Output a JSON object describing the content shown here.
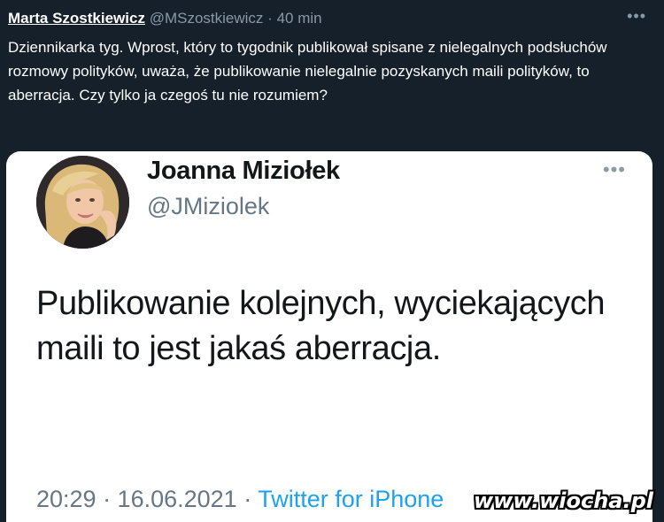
{
  "tweet": {
    "author_name": "Marta Szostkiewicz",
    "author_handle": "@MSzostkiewicz",
    "separator": "·",
    "time": "40 min",
    "more_icon": "more-horizontal-icon",
    "text": "Dziennikarka tyg. Wprost, który to tygodnik publikował spisane z nielegalnych podsłuchów rozmowy polityków, uważa, że publikowanie nielegalnie pozyskanych maili polityków, to aberracja. Czy tylko ja czegoś tu nie rozumiem?"
  },
  "embedded": {
    "author_name": "Joanna Miziołek",
    "author_handle": "@JMiziolek",
    "more_icon": "more-horizontal-icon",
    "text": "Publikowanie kolejnych, wyciekających maili to jest jakaś aberracja.",
    "footer_time": "20:29 · 16.06.2021 ·",
    "footer_source": "Twitter for iPhone"
  },
  "watermark": "www.wiocha.pl",
  "colors": {
    "background": "#15202b",
    "text_primary": "#ffffff",
    "text_secondary": "#8899a6",
    "link": "#1da1f2"
  }
}
